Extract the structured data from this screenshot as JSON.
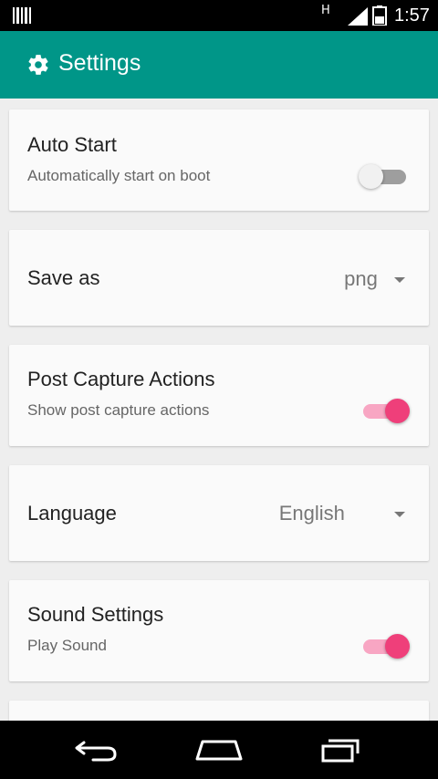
{
  "status_bar": {
    "network_type": "H",
    "time": "1:57"
  },
  "app_bar": {
    "title": "Settings",
    "icon": "gear-icon"
  },
  "settings": {
    "auto_start": {
      "title": "Auto Start",
      "subtitle": "Automatically start on boot",
      "enabled": false
    },
    "save_as": {
      "title": "Save as",
      "value": "png"
    },
    "post_capture": {
      "title": "Post Capture Actions",
      "subtitle": "Show post capture actions",
      "enabled": true
    },
    "language": {
      "title": "Language",
      "value": "English"
    },
    "sound": {
      "title": "Sound Settings",
      "subtitle": "Play Sound",
      "enabled": true
    }
  },
  "colors": {
    "app_bar": "#009688",
    "toggle_on_thumb": "#ef3f7a",
    "toggle_on_track": "#f8a6c3",
    "background": "#eeeeee"
  },
  "nav_bar": {
    "buttons": [
      "back-icon",
      "home-icon",
      "recents-icon"
    ]
  }
}
